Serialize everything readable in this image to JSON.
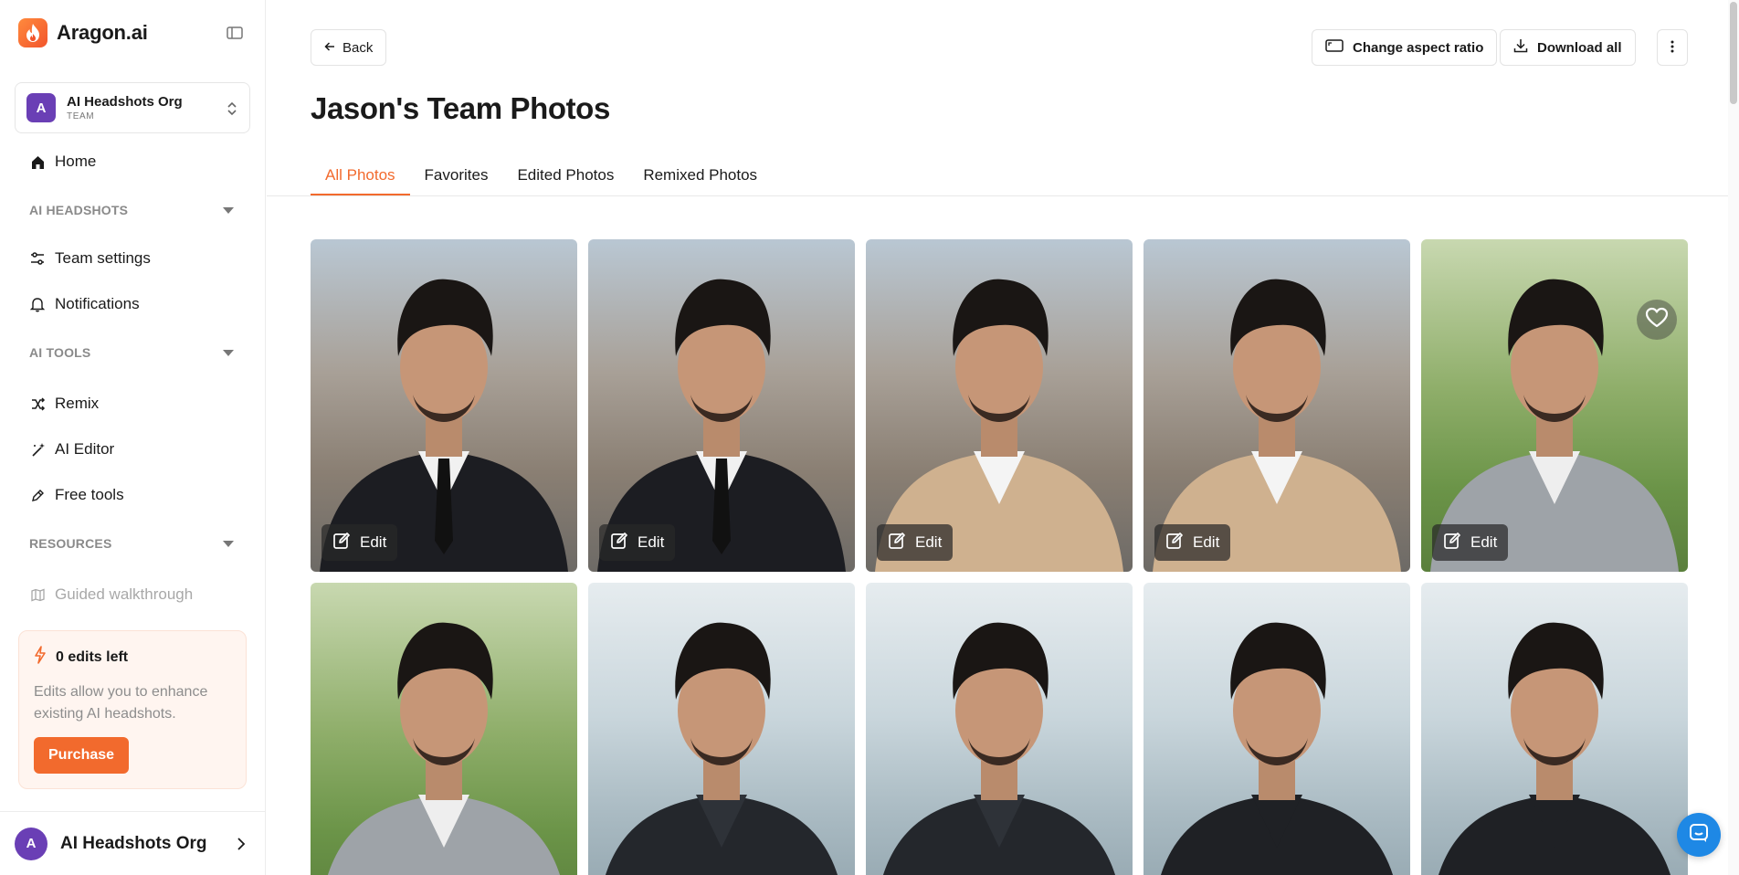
{
  "brand": {
    "name": "Aragon.ai"
  },
  "org_switcher": {
    "avatar": "A",
    "name": "AI Headshots Org",
    "type": "TEAM"
  },
  "nav": {
    "home": "Home",
    "section_headshots": "AI HEADSHOTS",
    "team_settings": "Team settings",
    "notifications": "Notifications",
    "section_tools": "AI TOOLS",
    "remix": "Remix",
    "ai_editor": "AI Editor",
    "free_tools": "Free tools",
    "section_resources": "RESOURCES",
    "guided_walkthrough": "Guided walkthrough"
  },
  "edits_card": {
    "title": "0 edits left",
    "description": "Edits allow you to enhance existing AI headshots.",
    "purchase": "Purchase"
  },
  "account": {
    "avatar": "A",
    "name": "AI Headshots Org"
  },
  "header": {
    "back": "Back",
    "change_aspect": "Change aspect ratio",
    "download_all": "Download all",
    "title": "Jason's Team Photos"
  },
  "tabs": [
    {
      "label": "All Photos",
      "active": true
    },
    {
      "label": "Favorites",
      "active": false
    },
    {
      "label": "Edited Photos",
      "active": false
    },
    {
      "label": "Remixed Photos",
      "active": false
    }
  ],
  "photos": [
    {
      "edit_label": "Edit",
      "scene": "street",
      "outfit": "black-suit"
    },
    {
      "edit_label": "Edit",
      "scene": "street",
      "outfit": "black-suit"
    },
    {
      "edit_label": "Edit",
      "scene": "street",
      "outfit": "beige-cardigan"
    },
    {
      "edit_label": "Edit",
      "scene": "street",
      "outfit": "beige-cardigan"
    },
    {
      "edit_label": "Edit",
      "scene": "park",
      "outfit": "grey-sweater",
      "favorite_visible": true
    },
    {
      "edit_label": "",
      "scene": "park",
      "outfit": "grey-sweater"
    },
    {
      "edit_label": "",
      "scene": "office",
      "outfit": "black-zip"
    },
    {
      "edit_label": "",
      "scene": "office",
      "outfit": "black-zip"
    },
    {
      "edit_label": "",
      "scene": "office",
      "outfit": "black-henley"
    },
    {
      "edit_label": "",
      "scene": "office",
      "outfit": "black-henley"
    }
  ],
  "colors": {
    "accent": "#f26a2d",
    "org_avatar": "#6a3fb5",
    "chat": "#1e88e5"
  }
}
